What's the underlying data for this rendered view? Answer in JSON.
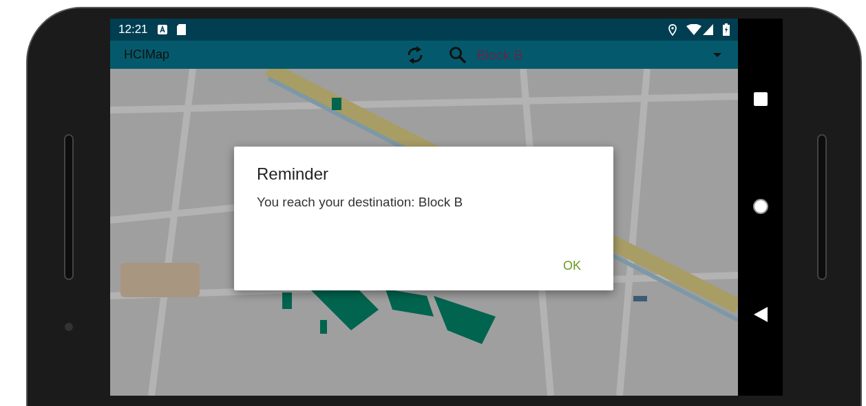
{
  "status_bar": {
    "time": "12:21"
  },
  "toolbar": {
    "title": "HCIMap",
    "destination": {
      "value": "Block B"
    }
  },
  "dialog": {
    "title": "Reminder",
    "message": "You reach your destination: Block B",
    "buttons": [
      "OK"
    ]
  }
}
